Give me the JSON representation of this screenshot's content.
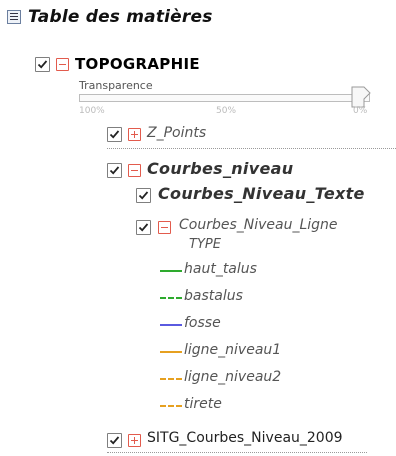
{
  "panel": {
    "title": "Table des matières"
  },
  "layers": {
    "topographie": {
      "label": "TOPOGRAPHIE",
      "checked": true
    },
    "transparence": {
      "label": "Transparence",
      "min_label": "100%",
      "mid_label": "50%",
      "max_label": "0%",
      "value_percent": 0
    },
    "z_points": {
      "label": "Z_Points",
      "checked": true
    },
    "courbes_niveau": {
      "label": "Courbes_niveau",
      "checked": true
    },
    "courbes_niveau_texte": {
      "label": "Courbes_Niveau_Texte",
      "checked": true
    },
    "courbes_niveau_ligne": {
      "label": "Courbes_Niveau_Ligne",
      "type_label": "TYPE",
      "checked": true
    },
    "sitg": {
      "label": "SITG_Courbes_Niveau_2009",
      "checked": true
    }
  },
  "legend": [
    {
      "label": "haut_talus",
      "style": "solid",
      "color": "#2eaa2e"
    },
    {
      "label": "bastalus",
      "style": "dashed",
      "color": "#2eaa2e"
    },
    {
      "label": "fosse",
      "style": "solid",
      "color": "#5a5ae0"
    },
    {
      "label": "ligne_niveau1",
      "style": "solid",
      "color": "#e6a020"
    },
    {
      "label": "ligne_niveau2",
      "style": "dashed",
      "color": "#e6a020"
    },
    {
      "label": "tirete",
      "style": "dashed",
      "color": "#e6a020"
    }
  ],
  "colors": {
    "expander_red": "#e25b4d",
    "checkbox_border": "#7f7f7f"
  },
  "icons": {
    "title": "toc-list-icon",
    "expand": "plus-box-icon",
    "collapse": "minus-box-icon",
    "check": "checkmark-icon"
  }
}
